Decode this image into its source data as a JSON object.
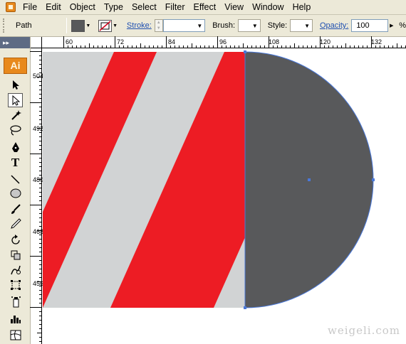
{
  "menubar": {
    "items": [
      "File",
      "Edit",
      "Object",
      "Type",
      "Select",
      "Filter",
      "Effect",
      "View",
      "Window",
      "Help"
    ]
  },
  "controlbar": {
    "object_type": "Path",
    "stroke_label": "Stroke:",
    "brush_label": "Brush:",
    "style_label": "Style:",
    "opacity_label": "Opacity:",
    "opacity_value": "100",
    "opacity_unit": "%"
  },
  "toolbox": {
    "badge": "Ai",
    "tools": [
      "selection-tool",
      "direct-selection-tool",
      "magic-wand-tool",
      "lasso-tool",
      "pen-tool",
      "type-tool",
      "line-segment-tool",
      "ellipse-tool",
      "paintbrush-tool",
      "pencil-tool",
      "rotate-tool",
      "scale-tool",
      "warp-tool",
      "free-transform-tool",
      "symbol-sprayer-tool",
      "column-graph-tool",
      "mesh-tool"
    ]
  },
  "rulers": {
    "top": [
      "60",
      "72",
      "84",
      "96",
      "108",
      "120",
      "132"
    ],
    "left": [
      "504",
      "492",
      "480",
      "468",
      "456"
    ]
  },
  "colors": {
    "stripe_red": "#ed1c24",
    "stripe_gray": "#d1d3d4",
    "shape_dark": "#58595b",
    "selection_blue": "#4a78d8"
  },
  "watermark": "weigeli.com"
}
